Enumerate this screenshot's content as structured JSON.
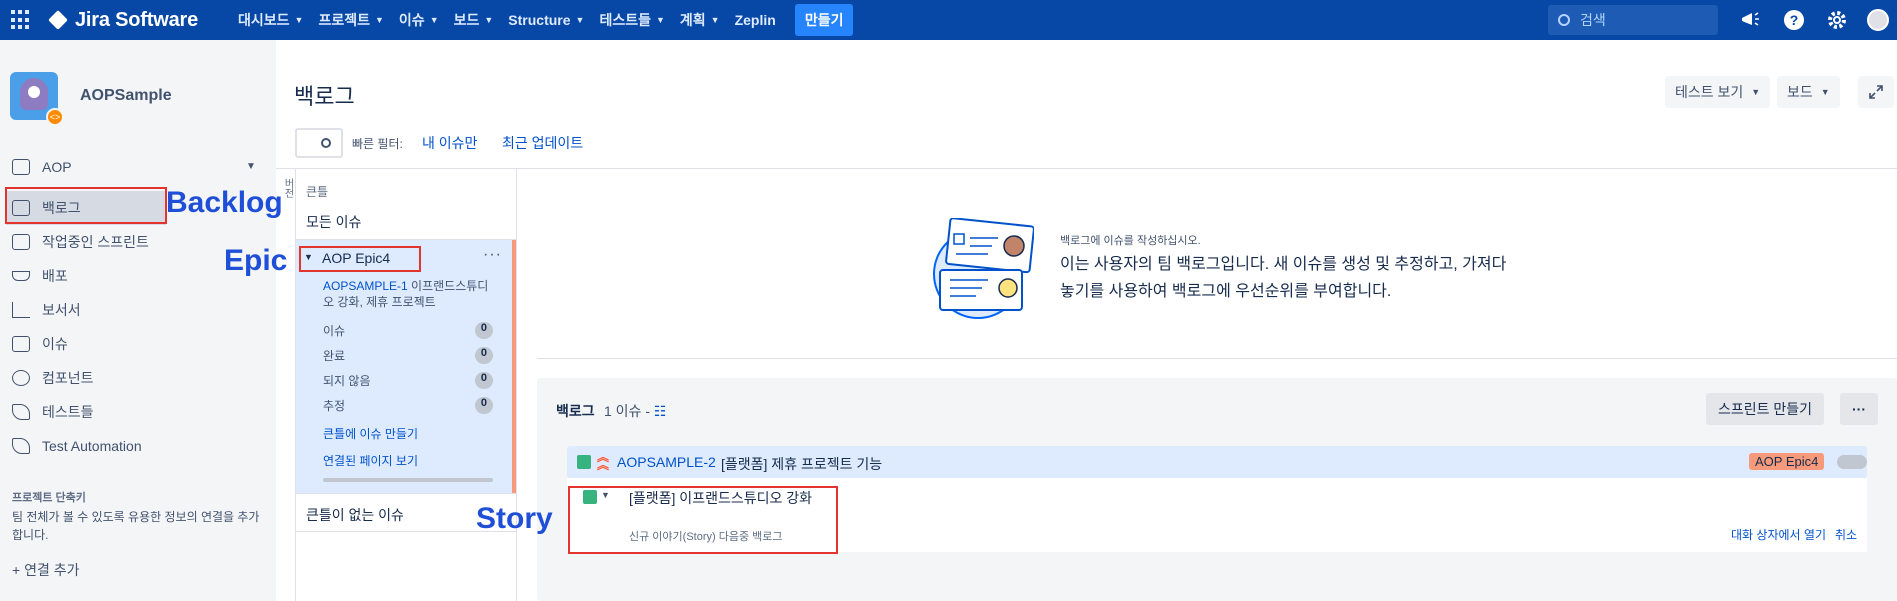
{
  "topnav": {
    "product": "Jira Software",
    "menu": [
      "대시보드",
      "프로젝트",
      "이슈",
      "보드",
      "Structure",
      "테스트들",
      "계획"
    ],
    "zeplin": "Zeplin",
    "create": "만들기",
    "search_placeholder": "검색",
    "help": "?"
  },
  "sidebar": {
    "project_name": "AOPSample",
    "board_name": "AOP",
    "items": [
      {
        "label": "백로그",
        "icon": "backlog-icon"
      },
      {
        "label": "작업중인 스프린트",
        "icon": "sprint-board-icon"
      },
      {
        "label": "배포",
        "icon": "ship-icon"
      },
      {
        "label": "보서서",
        "icon": "reports-icon"
      },
      {
        "label": "이슈",
        "icon": "issues-icon"
      },
      {
        "label": "컴포넌트",
        "icon": "components-icon"
      },
      {
        "label": "테스트들",
        "icon": "tests-icon"
      },
      {
        "label": "Test Automation",
        "icon": "test-automation-icon"
      }
    ],
    "shortcuts_title": "프로젝트 단축키",
    "shortcuts_desc": "팀 전체가 볼 수 있도록 유용한 정보의 연결을 추가합니다.",
    "add_link": "연결 추가"
  },
  "annotations": {
    "backlog": "Backlog",
    "epic": "Epic",
    "story": "Story"
  },
  "header": {
    "title": "백로그",
    "test_view": "테스트 보기",
    "board": "보드",
    "quick_filter_label": "빠른 필터:",
    "filter_mine": "내 이슈만",
    "filter_recent": "최근 업데이트"
  },
  "epic_panel": {
    "vertical_label": "버전",
    "header": "큰틀",
    "all_issues": "모든 이슈",
    "epic": {
      "name": "AOP Epic4",
      "issue_key": "AOPSAMPLE-1",
      "issue_summary": "이프랜드스튜디오 강화, 제휴 프로젝트",
      "stats": [
        {
          "label": "이슈",
          "count": "0"
        },
        {
          "label": "완료",
          "count": "0"
        },
        {
          "label": "되지 않음",
          "count": "0"
        },
        {
          "label": "추정",
          "count": "0"
        }
      ],
      "create_issue": "큰틀에 이슈 만들기",
      "linked_pages": "연결된 페이지 보기"
    },
    "no_epic": "큰틀이 없는 이슈"
  },
  "empty_state": {
    "small": "백로그에 이슈를 작성하십시오.",
    "text": "이는 사용자의 팀 백로그입니다. 새 이슈를 생성 및 추정하고, 가져다 놓기를 사용하여 백로그에 우선순위를 부여합니다."
  },
  "backlog": {
    "title": "백로그",
    "count": "1 이슈 -",
    "create_sprint": "스프린트 만들기",
    "rows": [
      {
        "key": "AOPSAMPLE-2",
        "summary": "[플랫폼] 제휴 프로젝트 기능",
        "epic": "AOP Epic4"
      }
    ],
    "new_issue": {
      "value": "[플랫폼]  이프랜드스튜디오  강화",
      "hint": "신규 이야기(Story) 다음중 백로그",
      "open_dialog": "대화 상자에서 열기",
      "cancel": "취소"
    }
  },
  "colors": {
    "nav": "#0747a6",
    "epic": "#f79a7b",
    "story": "#36b37e",
    "annotation": "#1f4fd6",
    "highlight": "#e3342f"
  }
}
